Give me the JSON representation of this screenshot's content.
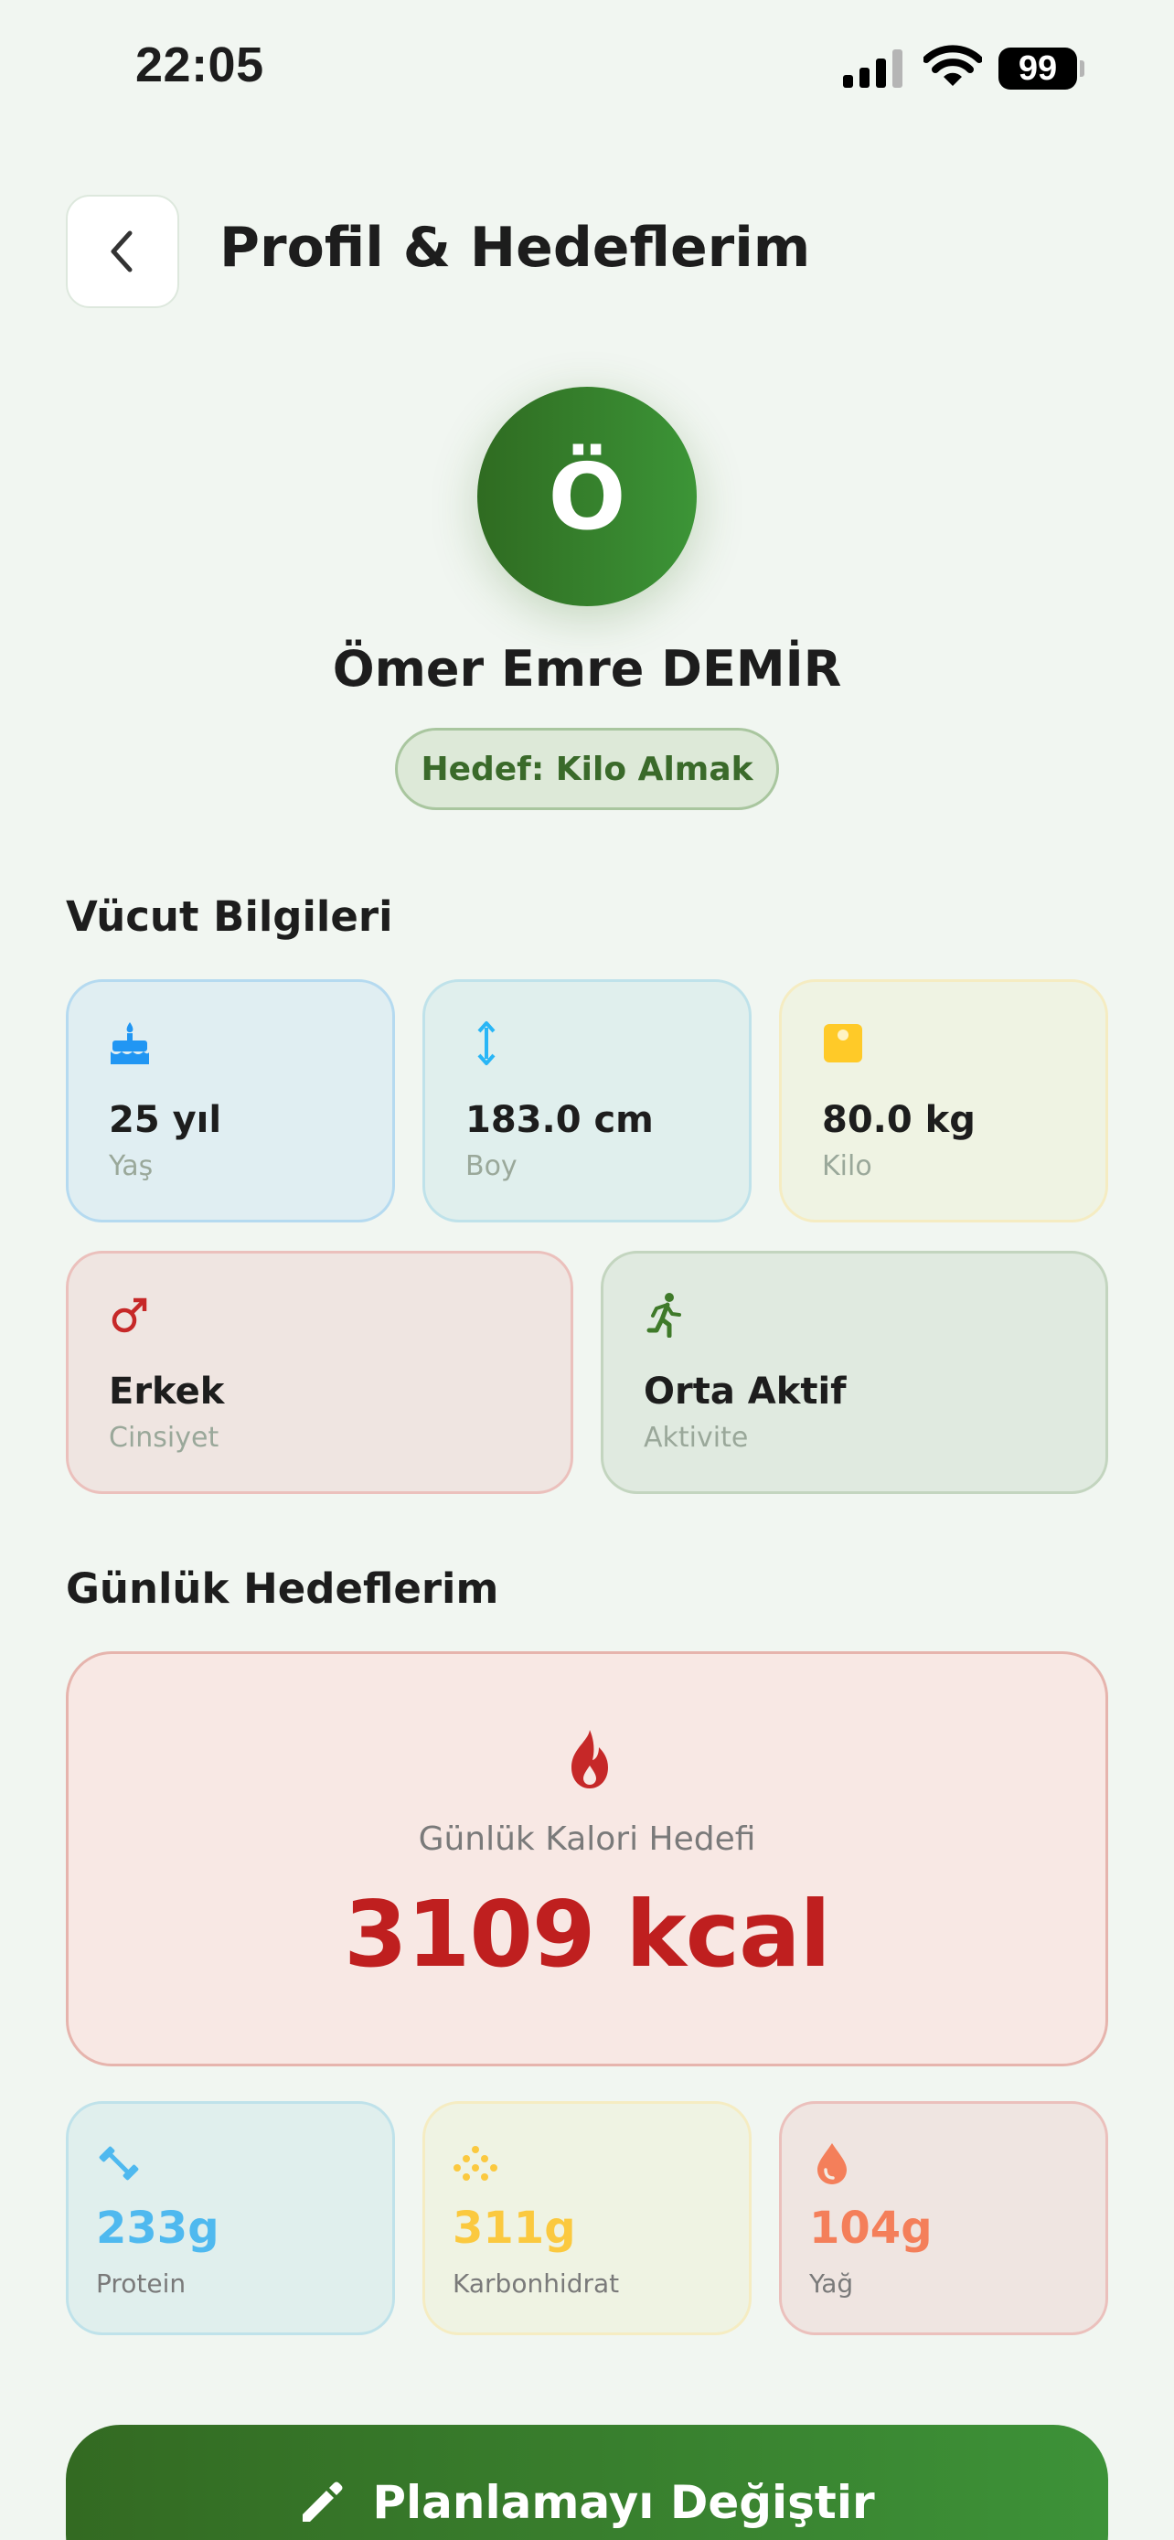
{
  "status_bar": {
    "time": "22:05",
    "battery": "99"
  },
  "header": {
    "title": "Profil & Hedeflerim",
    "back_icon": "chevron-left-icon"
  },
  "profile": {
    "initial": "Ö",
    "name": "Ömer Emre DEMİR",
    "goal": "Hedef: Kilo Almak"
  },
  "body_info": {
    "title": "Vücut Bilgileri",
    "items": [
      {
        "value": "25 yıl",
        "label": "Yaş",
        "icon": "cake-icon",
        "color": "#2196f3"
      },
      {
        "value": "183.0 cm",
        "label": "Boy",
        "icon": "height-arrows-icon",
        "color": "#29b6f6"
      },
      {
        "value": "80.0 kg",
        "label": "Kilo",
        "icon": "scale-icon",
        "color": "#ffca28"
      },
      {
        "value": "Erkek",
        "label": "Cinsiyet",
        "icon": "male-icon",
        "color": "#c62828"
      },
      {
        "value": "Orta Aktif",
        "label": "Aktivite",
        "icon": "running-icon",
        "color": "#3f7a2a"
      }
    ]
  },
  "daily_goals": {
    "title": "Günlük Hedeflerim",
    "calorie": {
      "label": "Günlük Kalori Hedefi",
      "value": "3109 kcal",
      "icon": "fire-icon",
      "color": "#c62828"
    },
    "macros": [
      {
        "value": "233g",
        "label": "Protein",
        "icon": "dumbbell-icon",
        "color": "#4fb9ef"
      },
      {
        "value": "311g",
        "label": "Karbonhidrat",
        "icon": "grain-icon",
        "color": "#fbc93f"
      },
      {
        "value": "104g",
        "label": "Yağ",
        "icon": "droplet-icon",
        "color": "#f47f5a"
      }
    ]
  },
  "cta": {
    "label": "Planlamayı Değiştir",
    "icon": "pencil-icon"
  }
}
